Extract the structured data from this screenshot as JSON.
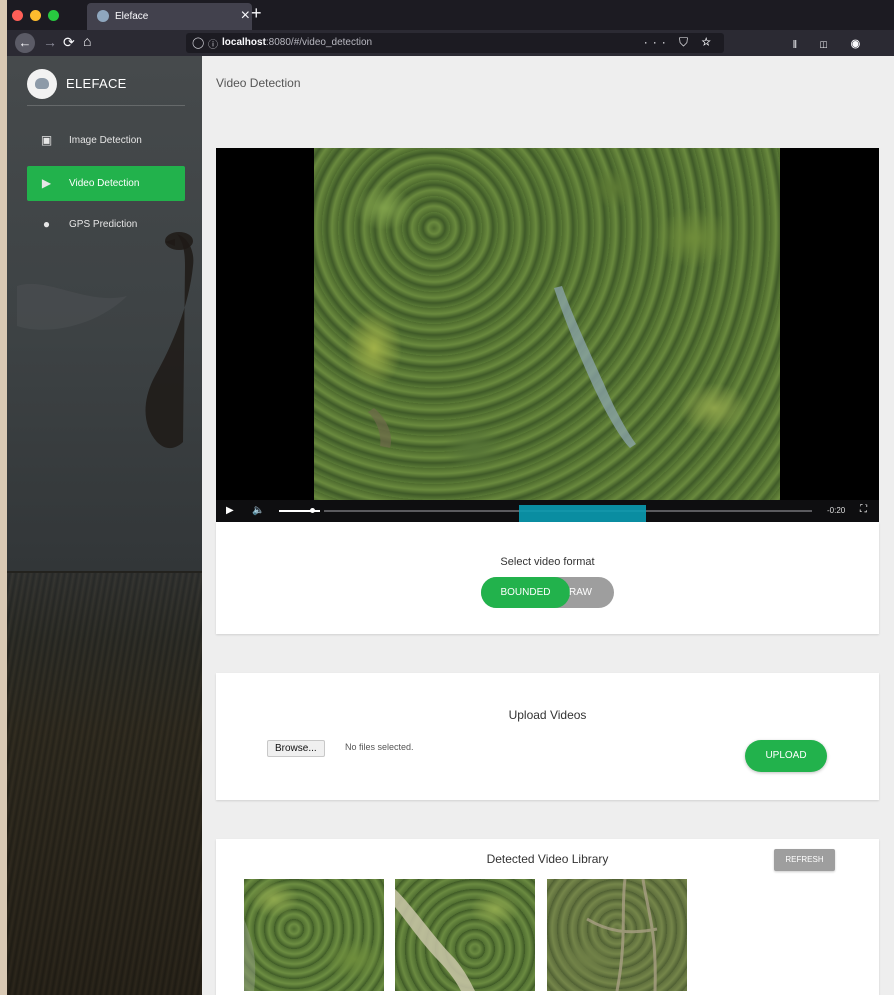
{
  "browser": {
    "tab_title": "Eleface",
    "tab_close": "×",
    "new_tab": "+",
    "url_host": "localhost",
    "url_path": ":8080/#/video_detection",
    "page_actions": "··· ⛉ ☆",
    "toolbar_icons": "𝍪 ◫ ◉ ✣"
  },
  "sidebar": {
    "brand": "ELEFACE",
    "items": [
      {
        "label": "Image Detection",
        "icon": "image-icon"
      },
      {
        "label": "Video Detection",
        "icon": "video-library-icon",
        "active": true
      },
      {
        "label": "GPS Prediction",
        "icon": "location-pin-icon"
      }
    ]
  },
  "main": {
    "page_title": "Video Detection",
    "player": {
      "time_remaining": "-0:20",
      "volume": 0.8,
      "playhead": 0.05,
      "buffered_start": 0.4,
      "buffered_end": 0.66
    },
    "format": {
      "label": "Select video format",
      "options": [
        "BOUNDED",
        "RAW"
      ],
      "selected": "BOUNDED"
    },
    "upload": {
      "title": "Upload Videos",
      "browse_label": "Browse...",
      "file_status": "No files selected.",
      "upload_label": "UPLOAD"
    },
    "library": {
      "title": "Detected Video Library",
      "refresh_label": "REFRESH"
    }
  },
  "colors": {
    "accent_green": "#22b24c",
    "toggle_off": "#9e9e9e",
    "seek_buffer": "#0a9bb1"
  }
}
